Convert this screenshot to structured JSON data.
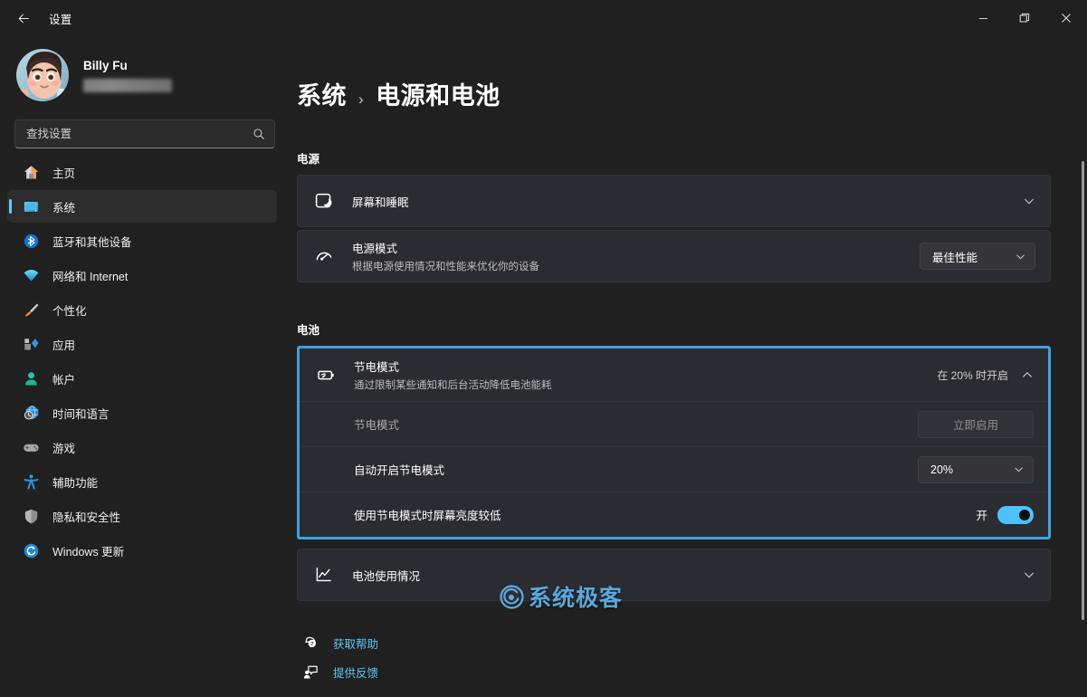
{
  "window": {
    "title": "设置",
    "back_icon": "arrow-left-icon",
    "minimize_label": "—",
    "maximize_label": "❐",
    "close_label": "✕"
  },
  "sidebar": {
    "account": {
      "name": "Billy Fu",
      "email_masked": ""
    },
    "search": {
      "placeholder": "查找设置",
      "value": "",
      "icon": "search-icon"
    },
    "items": [
      {
        "label": "主页",
        "icon": "home-icon",
        "selected": false
      },
      {
        "label": "系统",
        "icon": "system-monitor-icon",
        "selected": true
      },
      {
        "label": "蓝牙和其他设备",
        "icon": "bluetooth-icon",
        "selected": false
      },
      {
        "label": "网络和 Internet",
        "icon": "wifi-icon",
        "selected": false
      },
      {
        "label": "个性化",
        "icon": "paintbrush-icon",
        "selected": false
      },
      {
        "label": "应用",
        "icon": "apps-icon",
        "selected": false
      },
      {
        "label": "帐户",
        "icon": "account-person-icon",
        "selected": false
      },
      {
        "label": "时间和语言",
        "icon": "clock-globe-icon",
        "selected": false
      },
      {
        "label": "游戏",
        "icon": "gamepad-icon",
        "selected": false
      },
      {
        "label": "辅助功能",
        "icon": "accessibility-icon",
        "selected": false
      },
      {
        "label": "隐私和安全性",
        "icon": "shield-icon",
        "selected": false
      },
      {
        "label": "Windows 更新",
        "icon": "update-refresh-icon",
        "selected": false
      }
    ]
  },
  "main": {
    "breadcrumb": {
      "parent": "系统",
      "separator": "›",
      "current": "电源和电池"
    },
    "power_section": {
      "label": "电源",
      "cards": [
        {
          "title": "屏幕和睡眠",
          "subtitle": "",
          "icon": "screen-sleep-icon",
          "chevron": "chevron-down-icon"
        },
        {
          "title": "电源模式",
          "subtitle": "根据电源使用情况和性能来优化你的设备",
          "icon": "speedometer-icon",
          "dropdown_value": "最佳性能",
          "chevron": "chevron-down-icon"
        }
      ]
    },
    "battery_section": {
      "label": "电池",
      "battery_saver": {
        "title": "节电模式",
        "subtitle": "通过限制某些通知和后台活动降低电池能耗",
        "icon": "battery-saver-icon",
        "status": "在 20% 时开启",
        "chevron": "chevron-up-icon",
        "expanded": true,
        "rows": [
          {
            "label": "节电模式",
            "control": "button",
            "button_label": "立即启用",
            "disabled": true
          },
          {
            "label": "自动开启节电模式",
            "control": "dropdown",
            "dropdown_value": "20%",
            "chevron": "chevron-down-icon"
          },
          {
            "label": "使用节电模式时屏幕亮度较低",
            "control": "toggle",
            "toggle_state_label": "开",
            "toggle_on": true
          }
        ]
      },
      "battery_usage": {
        "title": "电池使用情况",
        "icon": "chart-line-icon",
        "chevron": "chevron-down-icon"
      }
    },
    "footer_links": [
      {
        "label": "获取帮助",
        "icon": "help-question-icon"
      },
      {
        "label": "提供反馈",
        "icon": "feedback-icon"
      }
    ]
  },
  "watermark": {
    "text": "系统极客",
    "logo_icon": "circle-swirl-logo-icon"
  },
  "colors": {
    "accent": "#60cdff",
    "toggle_on": "#4cc2ff",
    "highlight_border": "#3fa2e0",
    "link": "#5cc8f5",
    "window_bg": "#202020",
    "card_bg": "#2b2b32"
  }
}
